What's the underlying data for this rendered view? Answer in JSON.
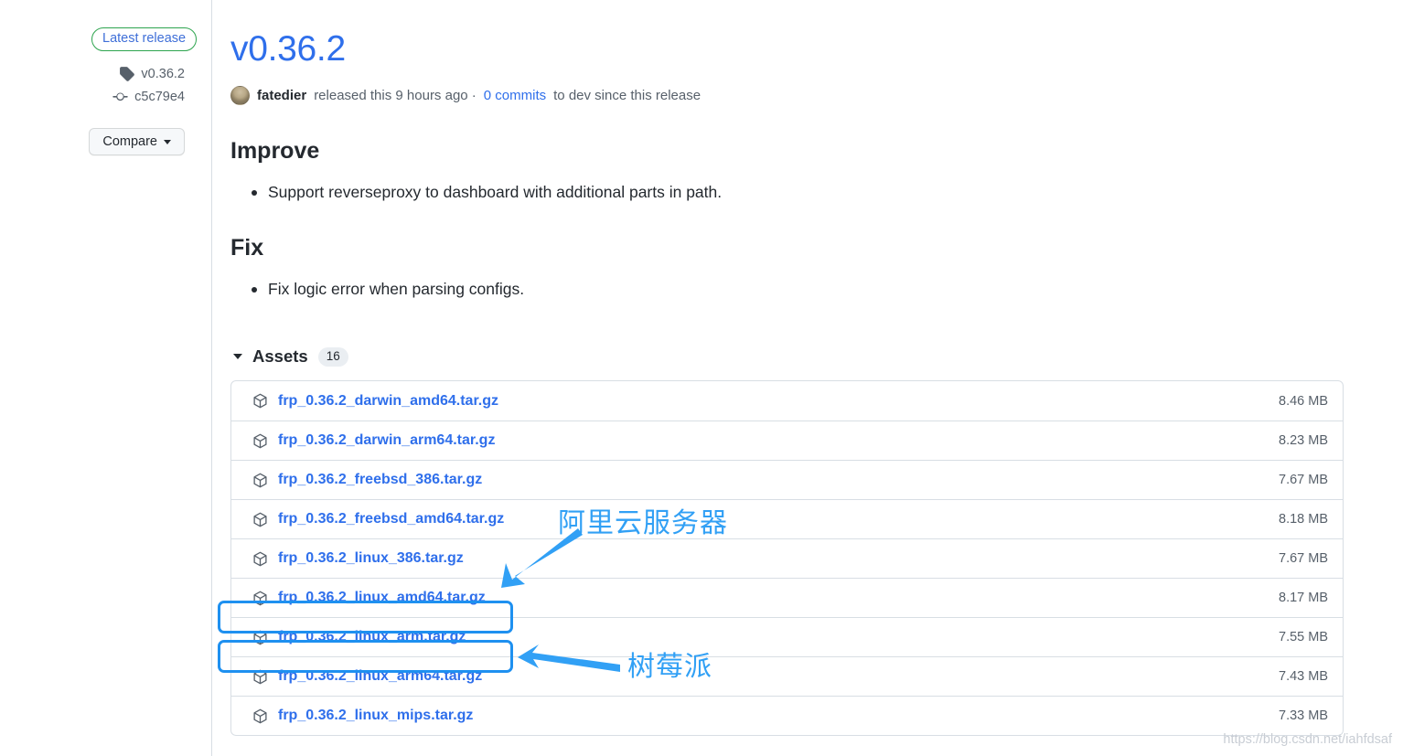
{
  "sidebar": {
    "latest_badge": "Latest release",
    "tag_icon": "tag-icon",
    "tag_value": "v0.36.2",
    "commit_icon": "git-commit-icon",
    "commit_value": "c5c79e4",
    "compare_label": "Compare",
    "compare_caret_icon": "chevron-down-icon"
  },
  "release": {
    "title": "v0.36.2",
    "avatar_icon": "user-avatar",
    "author": "fatedier",
    "released_text": "released this 9 hours ago ·",
    "commits_link": "0 commits",
    "since_text": "to dev since this release"
  },
  "body": {
    "improve_heading": "Improve",
    "improve_items": [
      "Support reverseproxy to dashboard with additional parts in path."
    ],
    "fix_heading": "Fix",
    "fix_items": [
      "Fix logic error when parsing configs."
    ]
  },
  "assets": {
    "toggle_icon": "triangle-down-icon",
    "label": "Assets",
    "count": "16",
    "row_icon": "package-icon",
    "rows": [
      {
        "name": "frp_0.36.2_darwin_amd64.tar.gz",
        "size": "8.46 MB",
        "highlighted": false
      },
      {
        "name": "frp_0.36.2_darwin_arm64.tar.gz",
        "size": "8.23 MB",
        "highlighted": false
      },
      {
        "name": "frp_0.36.2_freebsd_386.tar.gz",
        "size": "7.67 MB",
        "highlighted": false
      },
      {
        "name": "frp_0.36.2_freebsd_amd64.tar.gz",
        "size": "8.18 MB",
        "highlighted": false
      },
      {
        "name": "frp_0.36.2_linux_386.tar.gz",
        "size": "7.67 MB",
        "highlighted": false
      },
      {
        "name": "frp_0.36.2_linux_amd64.tar.gz",
        "size": "8.17 MB",
        "highlighted": true
      },
      {
        "name": "frp_0.36.2_linux_arm.tar.gz",
        "size": "7.55 MB",
        "highlighted": true
      },
      {
        "name": "frp_0.36.2_linux_arm64.tar.gz",
        "size": "7.43 MB",
        "highlighted": false
      },
      {
        "name": "frp_0.36.2_linux_mips.tar.gz",
        "size": "7.33 MB",
        "highlighted": false
      }
    ]
  },
  "annotations": {
    "color": "#31a0f5",
    "highlight_color": "#1e90f0",
    "items": [
      {
        "text": "阿里云服务器",
        "arrow": "arrow-down-left"
      },
      {
        "text": "树莓派",
        "arrow": "arrow-left"
      }
    ]
  },
  "watermark": "https://blog.csdn.net/iahfdsaf"
}
